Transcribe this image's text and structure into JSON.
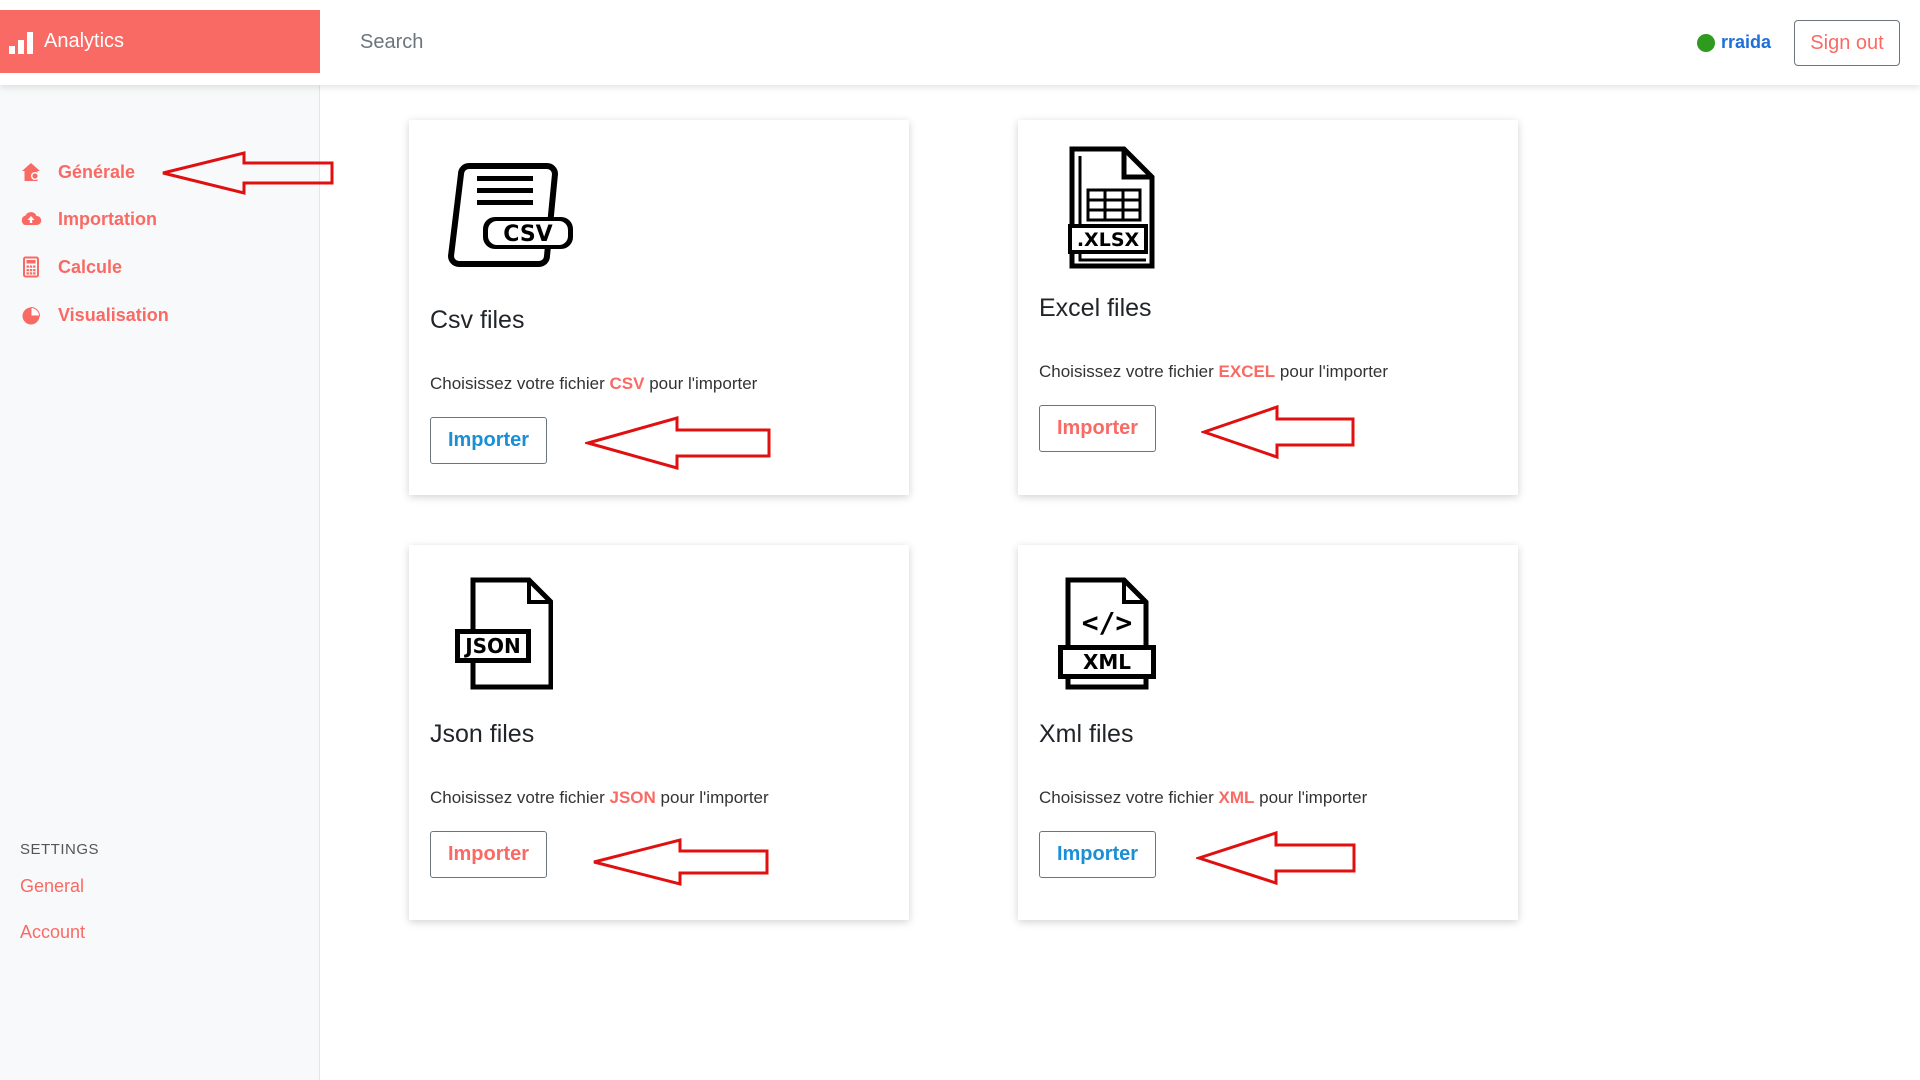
{
  "header": {
    "brand": "Analytics",
    "search_placeholder": "Search",
    "user": "rraida",
    "signout": "Sign out"
  },
  "sidebar": {
    "items": [
      {
        "label": "Générale",
        "icon": "home-icon"
      },
      {
        "label": "Importation",
        "icon": "cloud-upload-icon"
      },
      {
        "label": "Calcule",
        "icon": "calculator-icon"
      },
      {
        "label": "Visualisation",
        "icon": "pie-chart-icon"
      }
    ],
    "settings_heading": "SETTINGS",
    "settings_links": [
      "General",
      "Account"
    ]
  },
  "cards": [
    {
      "title": "Csv files",
      "text_before": "Choisissez votre fichier ",
      "highlight": "CSV",
      "text_after": " pour l'importer",
      "button": "Importer",
      "icon_label": "CSV"
    },
    {
      "title": "Excel files",
      "text_before": "Choisissez votre fichier ",
      "highlight": "EXCEL",
      "text_after": " pour l'importer",
      "button": "Importer",
      "icon_label": ".XLSX"
    },
    {
      "title": "Json files",
      "text_before": "Choisissez votre fichier ",
      "highlight": "JSON",
      "text_after": " pour l'importer",
      "button": "Importer",
      "icon_label": "JSON"
    },
    {
      "title": "Xml files",
      "text_before": "Choisissez votre fichier ",
      "highlight": "XML",
      "text_after": " pour l'importer",
      "button": "Importer",
      "icon_label": "XML",
      "icon_code": "</>"
    }
  ],
  "colors": {
    "accent": "#fa6a64",
    "link_blue": "#1a8fd6",
    "online": "#2e9a1e",
    "annotation_arrow": "#e01010"
  }
}
